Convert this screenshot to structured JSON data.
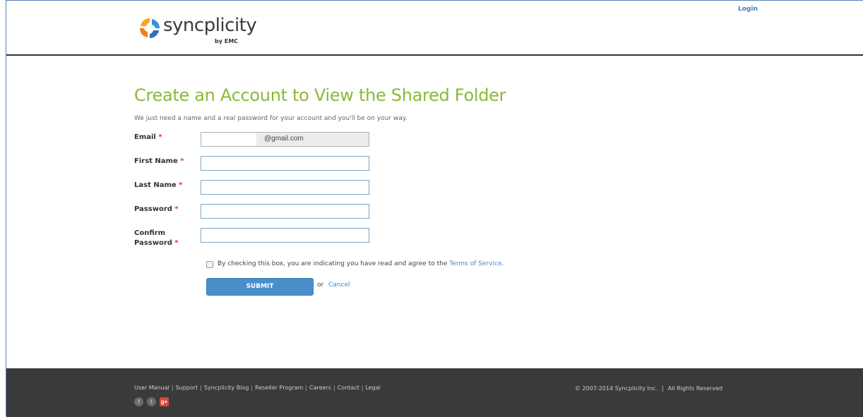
{
  "header": {
    "brand": "syncplicity",
    "brand_sub": "by EMC",
    "login": "Login"
  },
  "form": {
    "title": "Create an Account to View the Shared Folder",
    "subtitle": "We just need a name and a real password for your account and you'll be on your way.",
    "required_marker": "*",
    "fields": [
      {
        "label": "Email",
        "value": "@gmail.com",
        "placeholder": ""
      },
      {
        "label": "First Name",
        "value": "",
        "placeholder": ""
      },
      {
        "label": "Last Name",
        "value": "",
        "placeholder": ""
      },
      {
        "label": "Password",
        "value": "",
        "placeholder": ""
      },
      {
        "label_line1": "Confirm",
        "label_line2": "Password",
        "value": "",
        "placeholder": ""
      }
    ],
    "terms_text": "By checking this box, you are indicating you have read and agree to the",
    "terms_link": "Terms of Service",
    "terms_period": ".",
    "terms_checked": false,
    "submit": "SUBMIT",
    "or": "or",
    "cancel": "Cancel"
  },
  "footer": {
    "links": [
      "User Manual",
      "Support",
      "Syncplicity Blog",
      "Reseller Program",
      "Careers",
      "Contact",
      "Legal"
    ],
    "separator": "|",
    "copyright": "© 2007-2014 Syncplicity Inc.",
    "rights": "All Rights Reserved",
    "social": [
      {
        "icon": "facebook-icon",
        "glyph": "f"
      },
      {
        "icon": "twitter-icon",
        "glyph": "t"
      },
      {
        "icon": "google-plus-icon",
        "glyph": "g+"
      }
    ]
  },
  "colors": {
    "title": "#8db73a",
    "link": "#4a86c5",
    "submit": "#4a8fc9",
    "footer_bg": "#3a3a3a",
    "required": "#d93a3a"
  }
}
